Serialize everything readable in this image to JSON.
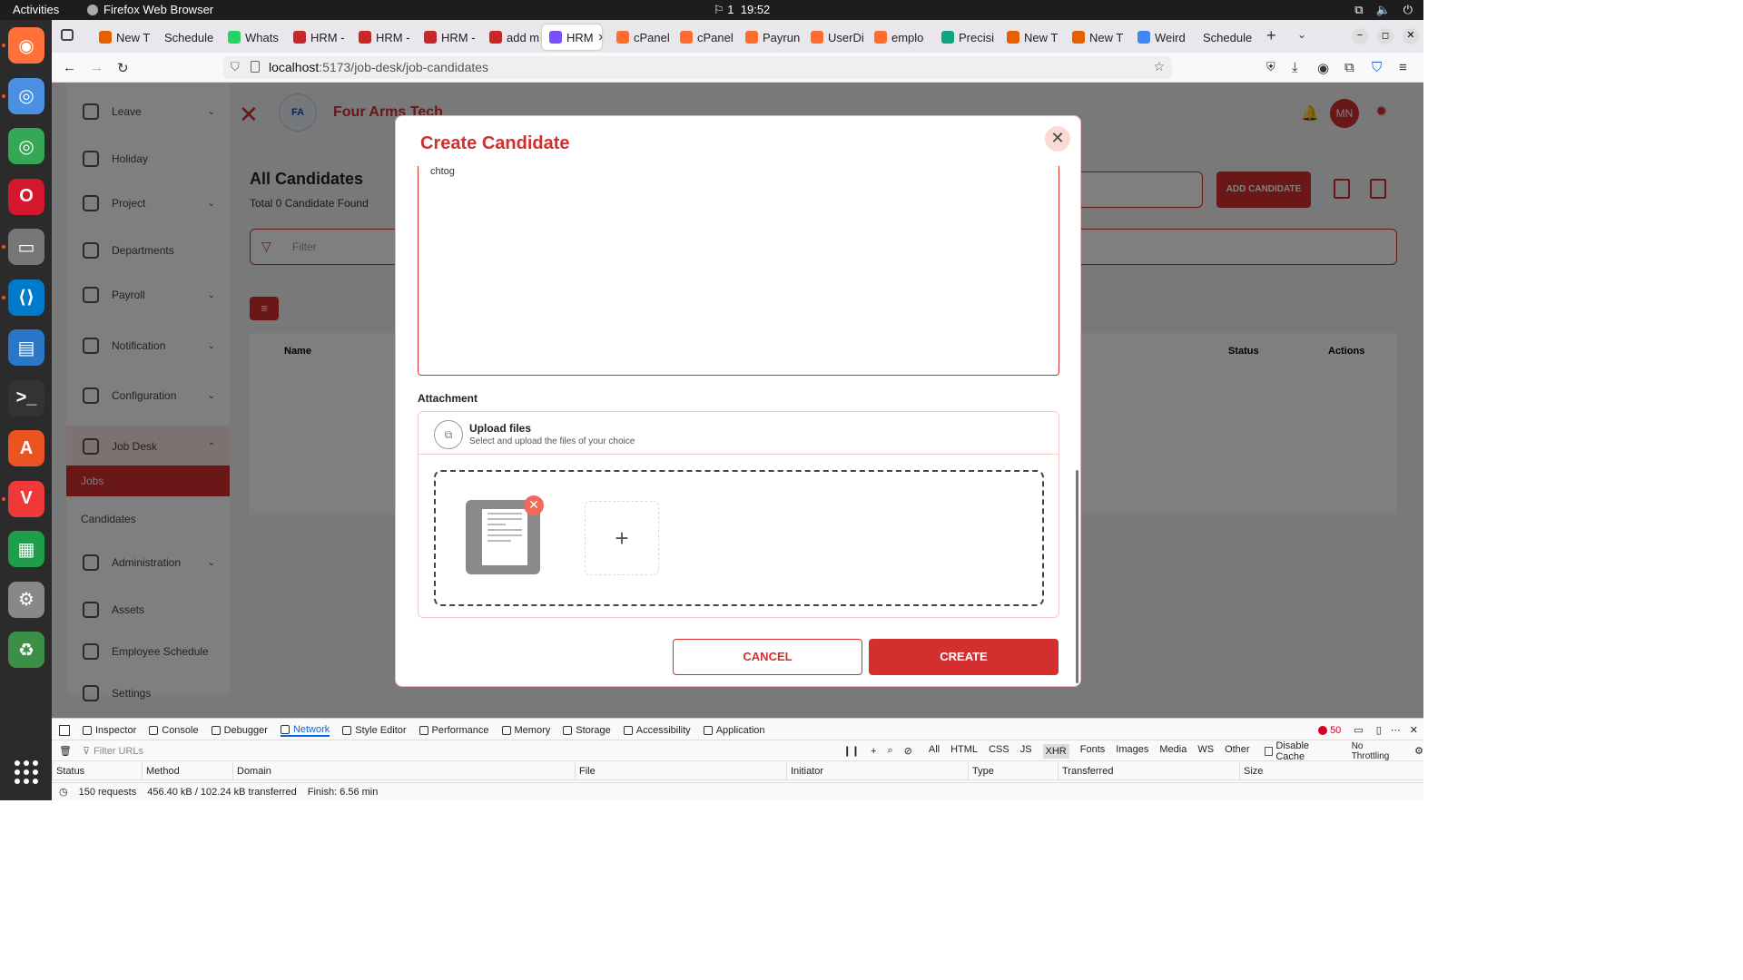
{
  "os_bar": {
    "activities": "Activities",
    "app_name": "Firefox Web Browser",
    "clock": "19:52",
    "indicator": "1"
  },
  "dock": {
    "apps": [
      "firefox-icon",
      "chromium-icon",
      "chrome-icon",
      "opera-icon",
      "files-icon",
      "vscode-icon",
      "writer-icon",
      "terminal-icon",
      "app-center-icon",
      "vivaldi-icon",
      "calc-icon",
      "settings-icon",
      "trash-icon"
    ]
  },
  "tabs": [
    {
      "label": "New T",
      "color": "#e66000"
    },
    {
      "label": "Schedule",
      "color": ""
    },
    {
      "label": "Whats",
      "color": "#25d366"
    },
    {
      "label": "HRM -",
      "color": "#c62828"
    },
    {
      "label": "HRM -",
      "color": "#c62828"
    },
    {
      "label": "HRM -",
      "color": "#c62828"
    },
    {
      "label": "add m",
      "color": "#c62828"
    },
    {
      "label": "HRM",
      "color": "#7c4dff"
    },
    {
      "label": "cPanel",
      "color": "#ff6c2c"
    },
    {
      "label": "cPanel",
      "color": "#ff6c2c"
    },
    {
      "label": "Payrun",
      "color": "#ff6c2c"
    },
    {
      "label": "UserDi",
      "color": "#ff6c2c"
    },
    {
      "label": "emplo",
      "color": "#ff6c2c"
    },
    {
      "label": "Precisi",
      "color": "#10a37f"
    },
    {
      "label": "New T",
      "color": "#e66000"
    },
    {
      "label": "New T",
      "color": "#e66000"
    },
    {
      "label": "Weird",
      "color": "#4285f4"
    },
    {
      "label": "Schedule",
      "color": ""
    }
  ],
  "url": {
    "host": "localhost",
    "path": ":5173/job-desk/job-candidates"
  },
  "bg": {
    "brand": "Four Arms Tech",
    "page_title": "All Candidates",
    "subtitle": "Total 0 Candidate Found",
    "add_button": "ADD CANDIDATE",
    "filter_placeholder": "Filter",
    "col_name": "Name",
    "col_status": "Status",
    "col_actions": "Actions",
    "avatar": "MN",
    "sidebar": [
      {
        "label": "Leave",
        "chev": true
      },
      {
        "label": "Holiday",
        "chev": false
      },
      {
        "label": "Project",
        "chev": true
      },
      {
        "label": "Departments",
        "chev": false
      },
      {
        "label": "Payroll",
        "chev": true
      },
      {
        "label": "Notification",
        "chev": true
      },
      {
        "label": "Configuration",
        "chev": true
      },
      {
        "label": "Job Desk",
        "chev": true
      },
      {
        "label": "Jobs",
        "chev": false
      },
      {
        "label": "Candidates",
        "chev": false
      },
      {
        "label": "Administration",
        "chev": true
      },
      {
        "label": "Assets",
        "chev": false
      },
      {
        "label": "Employee Schedule",
        "chev": false
      },
      {
        "label": "Settings",
        "chev": false
      }
    ]
  },
  "modal": {
    "title": "Create Candidate",
    "textarea_value": "chtog",
    "attachment_label": "Attachment",
    "upload_title": "Upload files",
    "upload_subtitle": "Select and upload the files of your choice",
    "cancel": "CANCEL",
    "create": "CREATE"
  },
  "devtools": {
    "tabs": [
      "Inspector",
      "Console",
      "Debugger",
      "Network",
      "Style Editor",
      "Performance",
      "Memory",
      "Storage",
      "Accessibility",
      "Application"
    ],
    "selected_tab": "Network",
    "errors": "50",
    "filter_placeholder": "Filter URLs",
    "filters": [
      "All",
      "HTML",
      "CSS",
      "JS",
      "XHR",
      "Fonts",
      "Images",
      "Media",
      "WS",
      "Other"
    ],
    "selected_filter": "XHR",
    "disable_cache": "Disable Cache",
    "throttling": "No Throttling",
    "columns": [
      "Status",
      "Method",
      "Domain",
      "File",
      "Initiator",
      "Type",
      "Transferred",
      "Size"
    ],
    "requests": "150 requests",
    "transferred": "456.40 kB / 102.24 kB transferred",
    "finish": "Finish: 6.56 min"
  }
}
